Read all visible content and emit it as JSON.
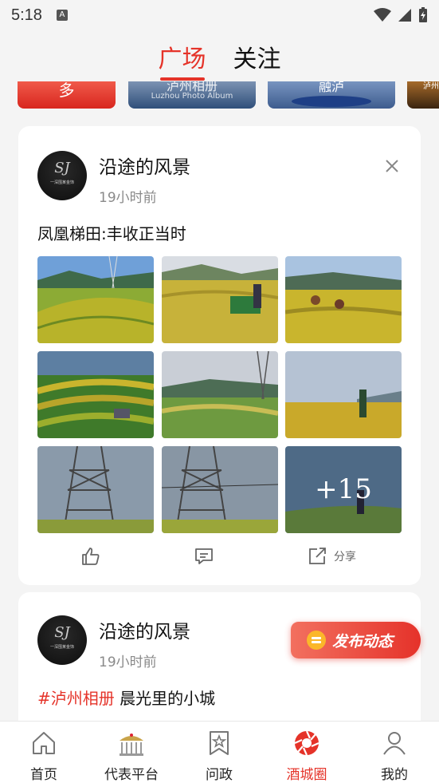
{
  "status_bar": {
    "time": "5:18",
    "notification_icon": "A"
  },
  "top_tabs": [
    {
      "label": "广场",
      "active": true
    },
    {
      "label": "关注",
      "active": false
    }
  ],
  "banners": [
    {
      "title": "多"
    },
    {
      "title": "泸州相册",
      "subtitle": "Luzhou Photo Album"
    },
    {
      "title": "融泸"
    },
    {
      "title": "泸州"
    }
  ],
  "posts": [
    {
      "author": "沿途的风景",
      "avatar_text": "SJ",
      "avatar_caption": "一深围某金饰",
      "time_ago": "19小时前",
      "title": "凤凰梯田:丰收正当时",
      "more_count": "+15",
      "share_label": "分享"
    },
    {
      "author": "沿途的风景",
      "avatar_text": "SJ",
      "avatar_caption": "一深围某金饰",
      "time_ago": "19小时前",
      "tag": "#泸州相册",
      "title": "晨光里的小城"
    }
  ],
  "fab": {
    "label": "发布动态"
  },
  "bottom_nav": [
    {
      "label": "首页",
      "icon": "home-icon",
      "active": false
    },
    {
      "label": "代表平台",
      "icon": "hall-icon",
      "active": false
    },
    {
      "label": "问政",
      "icon": "bookmark-star-icon",
      "active": false
    },
    {
      "label": "酒城圈",
      "icon": "camera-shutter-icon",
      "active": true
    },
    {
      "label": "我的",
      "icon": "user-icon",
      "active": false
    }
  ],
  "colors": {
    "accent": "#e53329",
    "fab_icon": "#fbb72a"
  }
}
